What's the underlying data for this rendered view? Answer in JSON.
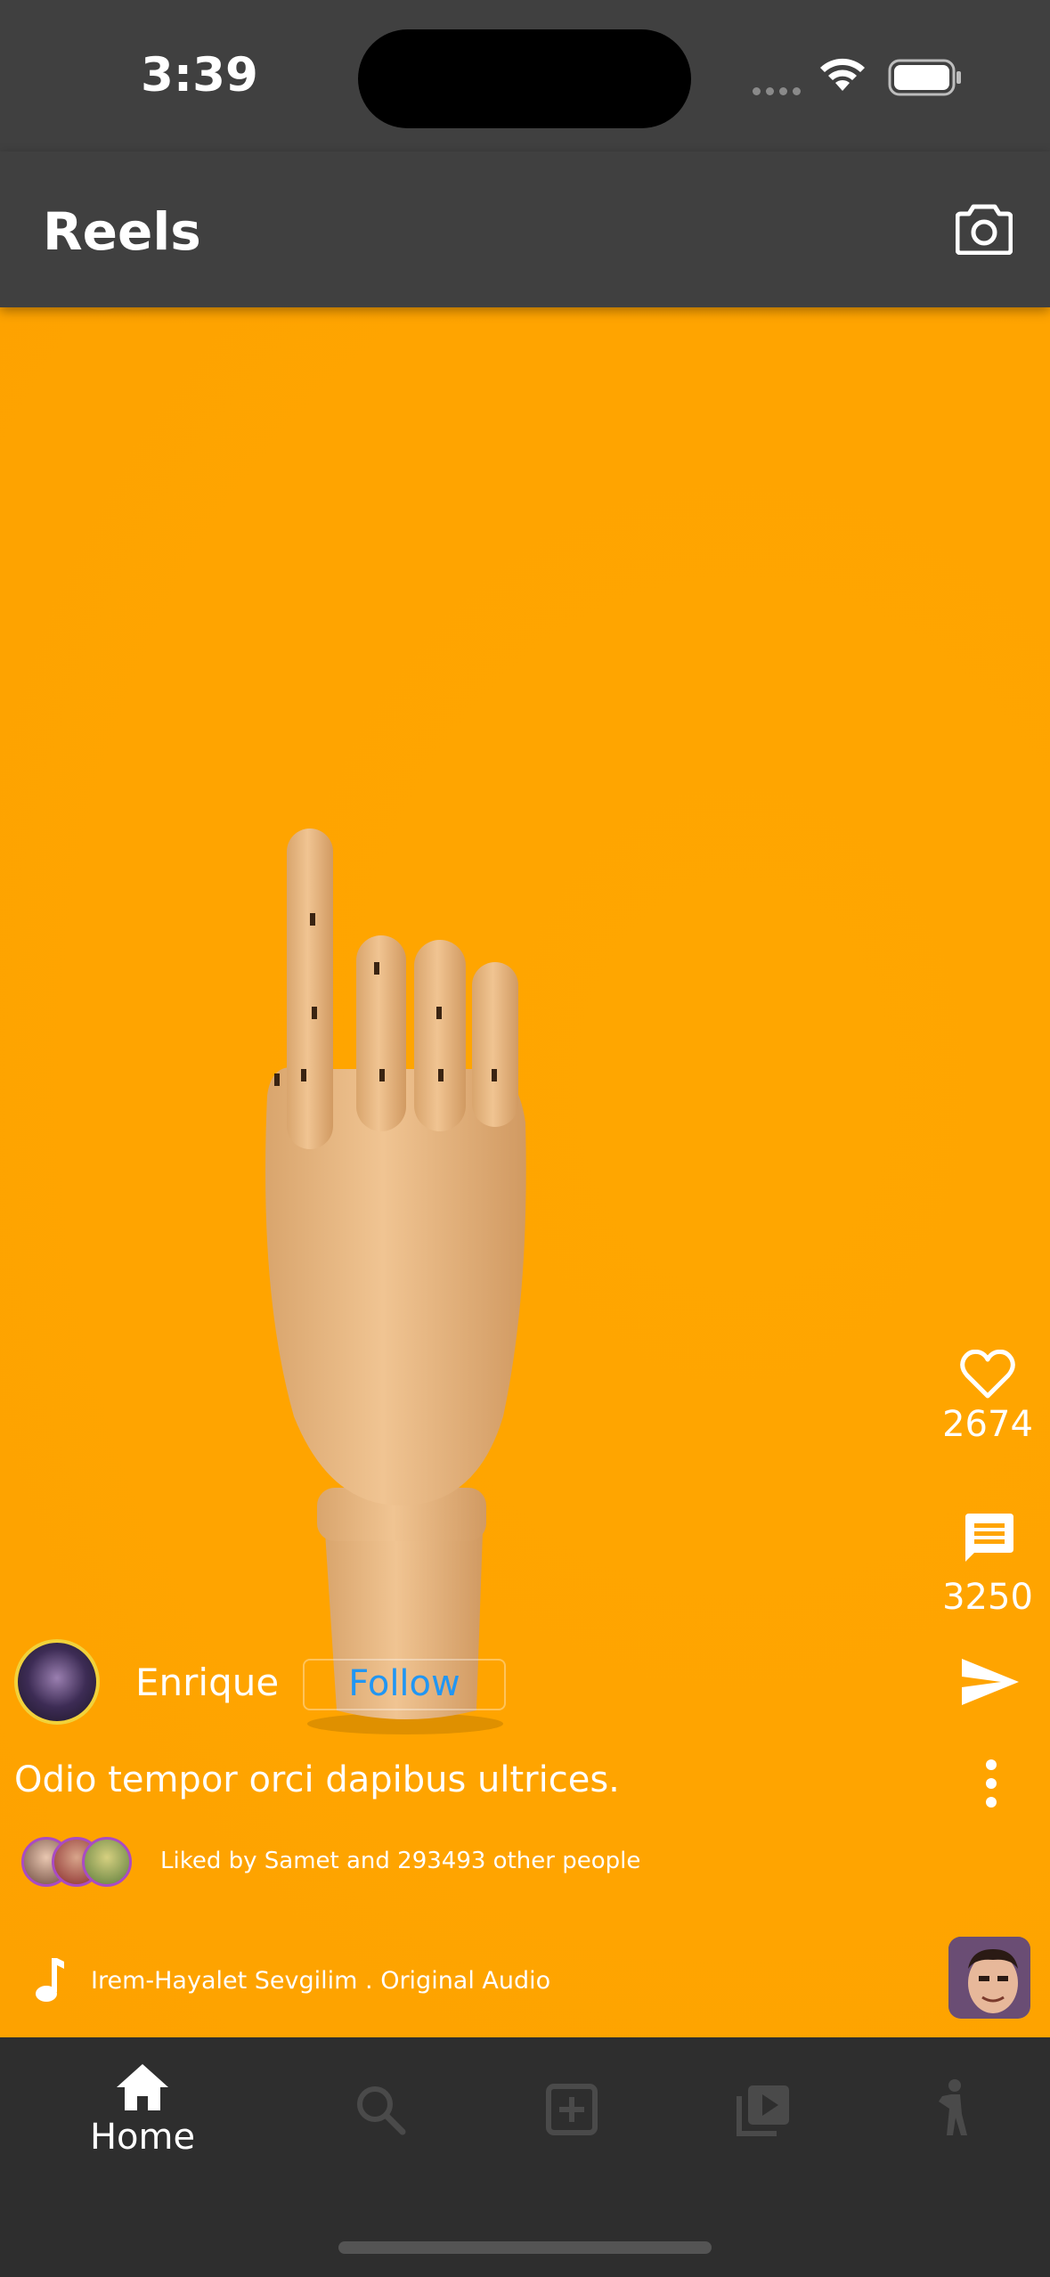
{
  "status_bar": {
    "time": "3:39"
  },
  "app_bar": {
    "title": "Reels"
  },
  "reel": {
    "likes": "2674",
    "comments": "3250",
    "username": "Enrique",
    "follow_label": "Follow",
    "caption": "Odio tempor orci dapibus ultrices.",
    "liked_by": "Liked by Samet and 293493 other people",
    "audio": "Irem-Hayalet Sevgilim . Original Audio"
  },
  "bottom_nav": {
    "home_label": "Home"
  },
  "colors": {
    "background": "#ffa500",
    "bar": "#404040",
    "nav": "#2e2e2e",
    "follow_text": "#2196f3"
  },
  "icons": [
    "camera-icon",
    "heart-icon",
    "comment-icon",
    "send-icon",
    "more-vert-icon",
    "music-note-icon",
    "home-icon",
    "search-icon",
    "add-box-icon",
    "video-library-icon",
    "person-icon"
  ]
}
